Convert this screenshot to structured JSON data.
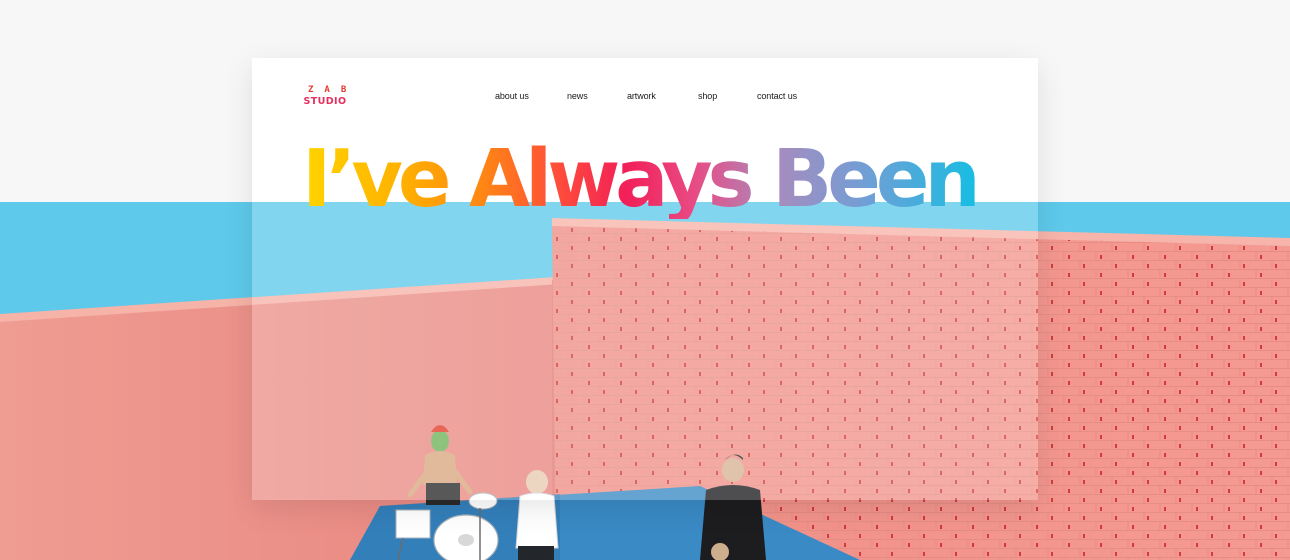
{
  "site": {
    "logo": {
      "top": "ZAB",
      "bottom": "STUDIO"
    },
    "nav": [
      {
        "label": "about us"
      },
      {
        "label": "news"
      },
      {
        "label": "artwork"
      },
      {
        "label": "shop"
      },
      {
        "label": "contact us"
      }
    ]
  },
  "hero": {
    "headline": "I’ve Always Been",
    "photo": "pink-brick-courtyard-band-rehearsal"
  },
  "colors": {
    "sky": "#5ec9ea",
    "wall": "#ef9a8f",
    "floor": "#3a8ac5",
    "logo_red": "#e52f5d",
    "gradient_start": "#ffd400",
    "gradient_mid": "#f21f58",
    "gradient_end": "#17bde2"
  }
}
